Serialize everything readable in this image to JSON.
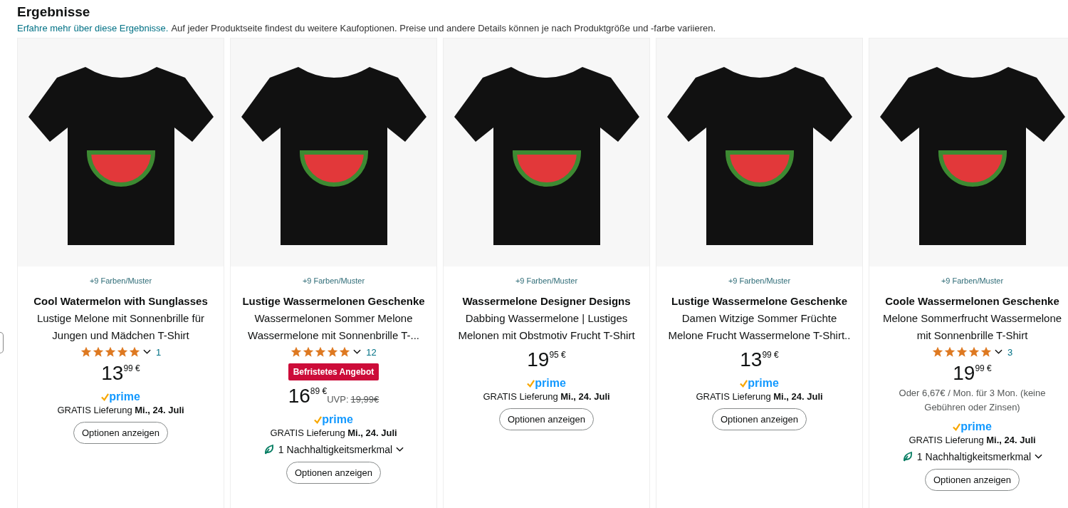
{
  "header": {
    "title": "Ergebnisse",
    "link": "Erfahre mehr über diese Ergebnisse.",
    "description": "Auf jeder Produktseite findest du weitere Kaufoptionen. Preise und andere Details können je nach Produktgröße und -farbe variieren."
  },
  "products": [
    {
      "variants": "+9 Farben/Muster",
      "brand": "Cool Watermelon with Sunglasses",
      "title_lines": [
        "Lustige Melone mit Sonnenbrille für",
        "Jungen und Mädchen T-Shirt"
      ],
      "stars": 5,
      "rating_count": "1",
      "price_whole": "13",
      "price_fraction": "99",
      "currency": "€",
      "prime": "prime",
      "delivery": "GRATIS Lieferung **Mi., 24. Juli**",
      "button": "Optionen anzeigen"
    },
    {
      "variants": "+9 Farben/Muster",
      "brand": "Lustige Wassermelonen Geschenke",
      "title_lines": [
        "Wassermelonen Sommer Melone",
        "Wassermelone mit Sonnenbrille T-..."
      ],
      "stars": 5,
      "rating_count": "12",
      "deal": "Befristetes Angebot",
      "price_whole": "16",
      "price_fraction": "89",
      "currency": "€",
      "uvp_label": "UVP:",
      "uvp_price": "19,99€",
      "prime": "prime",
      "delivery": "GRATIS Lieferung **Mi., 24. Juli**",
      "sustainability": "1 Nachhaltigkeitsmerkmal",
      "button": "Optionen anzeigen"
    },
    {
      "variants": "+9 Farben/Muster",
      "brand": "Wassermelone Designer Designs",
      "title_lines": [
        "Dabbing Wassermelone | Lustiges",
        "Melonen mit Obstmotiv Frucht T-Shirt"
      ],
      "price_whole": "19",
      "price_fraction": "95",
      "currency": "€",
      "prime": "prime",
      "delivery": "GRATIS Lieferung **Mi., 24. Juli**",
      "button": "Optionen anzeigen"
    },
    {
      "variants": "+9 Farben/Muster",
      "brand": "Lustige Wassermelone Geschenke",
      "title_lines": [
        "Damen Witzige Sommer Früchte",
        "Melone Frucht Wassermelone T-Shirt.."
      ],
      "price_whole": "13",
      "price_fraction": "99",
      "currency": "€",
      "prime": "prime",
      "delivery": "GRATIS Lieferung **Mi., 24. Juli**",
      "button": "Optionen anzeigen"
    },
    {
      "variants": "+9 Farben/Muster",
      "brand": "Coole Wassermelonen Geschenke",
      "title_lines": [
        "Melone Sommerfrucht Wassermelone",
        "mit Sonnenbrille T-Shirt"
      ],
      "stars": 5,
      "rating_count": "3",
      "price_whole": "19",
      "price_fraction": "99",
      "currency": "€",
      "installment": "Oder 6,67€ / Mon. für 3 Mon. (keine Gebühren oder Zinsen)",
      "prime": "prime",
      "delivery": "GRATIS Lieferung **Mi., 24. Juli**",
      "sustainability": "1 Nachhaltigkeitsmerkmal",
      "button": "Optionen anzeigen"
    }
  ]
}
